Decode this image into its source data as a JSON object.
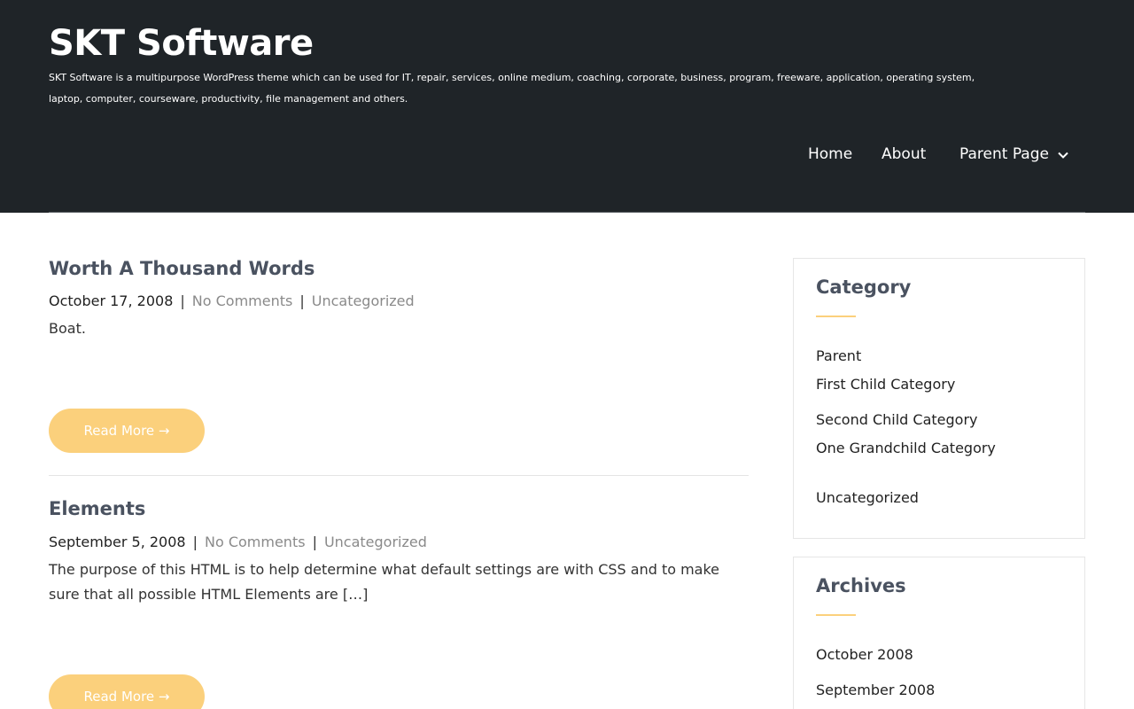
{
  "site": {
    "title": "SKT Software",
    "description": "SKT Software is a multipurpose WordPress theme which can be used for IT, repair, services, online medium, coaching, corporate, business, program, freeware, application, operating system, laptop, computer, courseware, productivity, file management and others."
  },
  "nav": {
    "items": [
      {
        "label": "Home"
      },
      {
        "label": "About"
      },
      {
        "label": "Parent Page",
        "icon": "chevron-down-icon"
      }
    ]
  },
  "posts": [
    {
      "title": "Worth A Thousand Words",
      "date": "October 17, 2008",
      "comments": "No Comments",
      "category": "Uncategorized",
      "excerpt": "Boat.",
      "read_more": "Read More →"
    },
    {
      "title": "Elements",
      "date": "September 5, 2008",
      "comments": "No Comments",
      "category": "Uncategorized",
      "excerpt": "The purpose of this HTML is to help determine what default settings are with CSS and to make sure that all possible HTML Elements are […]",
      "read_more": "Read More →"
    }
  ],
  "meta_separator": "|",
  "sidebar": {
    "category": {
      "title": "Category",
      "items": [
        "Parent",
        "First Child Category",
        "Second Child Category",
        "One Grandchild Category",
        "Uncategorized"
      ]
    },
    "archives": {
      "title": "Archives",
      "items": [
        "October 2008",
        "September 2008"
      ]
    }
  },
  "colors": {
    "header_bg": "#1f2428",
    "accent": "#fbd07c",
    "title": "#4a5260"
  }
}
